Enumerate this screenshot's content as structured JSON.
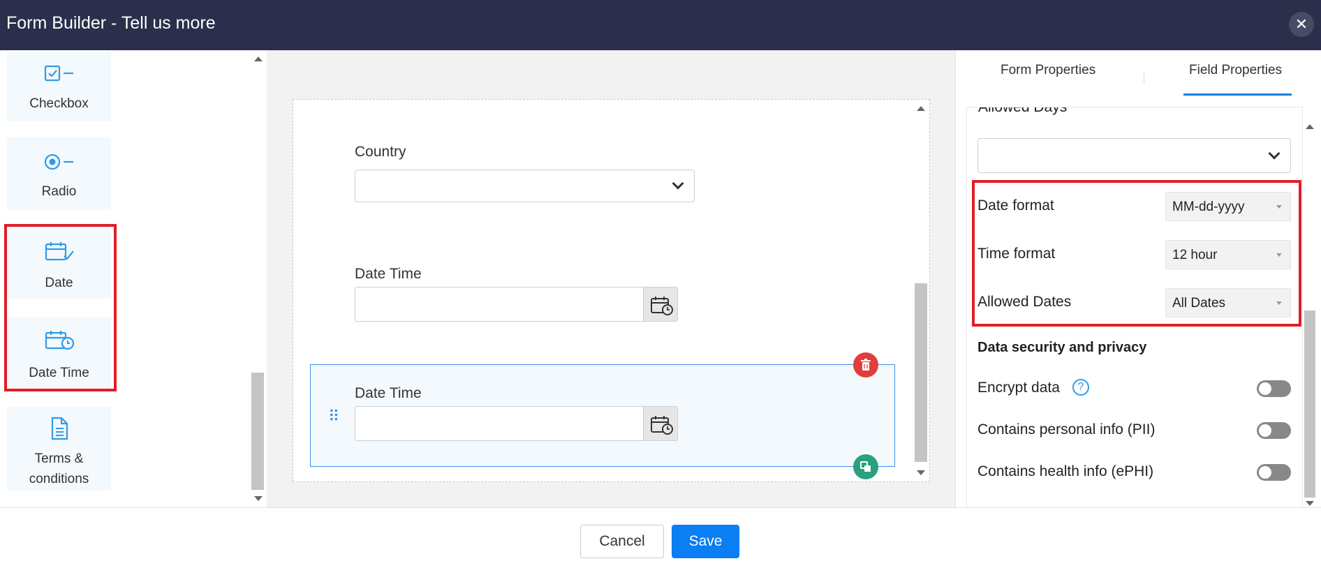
{
  "header": {
    "title": "Form Builder - Tell us more"
  },
  "palette": {
    "items": [
      {
        "label": "Checkbox",
        "icon": "checkbox-icon"
      },
      {
        "label": "Radio",
        "icon": "radio-icon"
      },
      {
        "label": "Date",
        "icon": "calendar-check-icon"
      },
      {
        "label": "Date Time",
        "icon": "calendar-clock-icon"
      },
      {
        "label_line1": "Terms &",
        "label_line2": "conditions",
        "icon": "document-icon"
      }
    ]
  },
  "canvas": {
    "fields": [
      {
        "label": "Country",
        "type": "dropdown",
        "value": ""
      },
      {
        "label": "Date Time",
        "type": "datetime",
        "value": ""
      },
      {
        "label": "Date Time",
        "type": "datetime",
        "value": "",
        "selected": true
      }
    ]
  },
  "panel": {
    "tabs": [
      {
        "label": "Form Properties",
        "active": false
      },
      {
        "label": "Field Properties",
        "active": true
      }
    ],
    "allowed_days_label": "Allowed Days",
    "allowed_days_value": "",
    "date_format": {
      "label": "Date format",
      "value": "MM-dd-yyyy"
    },
    "time_format": {
      "label": "Time format",
      "value": "12 hour"
    },
    "allowed_dates": {
      "label": "Allowed Dates",
      "value": "All Dates"
    },
    "security_title": "Data security and privacy",
    "toggles": [
      {
        "label": "Encrypt data",
        "on": false
      },
      {
        "label": "Contains personal info (PII)",
        "on": false
      },
      {
        "label": "Contains health info (ePHI)",
        "on": false
      }
    ]
  },
  "footer": {
    "cancel_label": "Cancel",
    "save_label": "Save"
  },
  "colors": {
    "header_bg": "#2b2f4b",
    "accent": "#0a7ef2",
    "highlight": "#e01e26",
    "icon_blue": "#2f9be8"
  }
}
